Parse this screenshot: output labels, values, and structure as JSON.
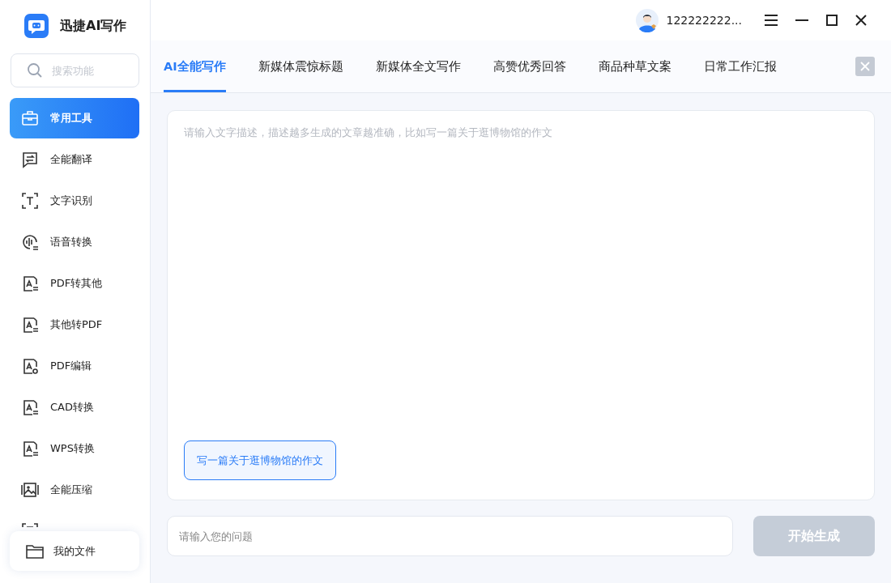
{
  "app": {
    "title": "迅捷AI写作"
  },
  "search": {
    "placeholder": "搜索功能"
  },
  "sidebar": {
    "items": [
      {
        "label": "常用工具",
        "kind": "toolbox",
        "selected": true
      },
      {
        "label": "全能翻译",
        "kind": "translate",
        "selected": false
      },
      {
        "label": "文字识别",
        "kind": "ocr",
        "selected": false
      },
      {
        "label": "语音转换",
        "kind": "voice",
        "selected": false
      },
      {
        "label": "PDF转其他",
        "kind": "pdf-out",
        "selected": false
      },
      {
        "label": "其他转PDF",
        "kind": "pdf-in",
        "selected": false
      },
      {
        "label": "PDF编辑",
        "kind": "pdf-edit",
        "selected": false
      },
      {
        "label": "CAD转换",
        "kind": "cad",
        "selected": false
      },
      {
        "label": "WPS转换",
        "kind": "wps",
        "selected": false
      },
      {
        "label": "全能压缩",
        "kind": "compress",
        "selected": false
      }
    ],
    "files": "我的文件"
  },
  "user": {
    "name": "122222222..."
  },
  "tabs": [
    {
      "label": "AI全能写作",
      "selected": true
    },
    {
      "label": "新媒体震惊标题",
      "selected": false
    },
    {
      "label": "新媒体全文写作",
      "selected": false
    },
    {
      "label": "高赞优秀回答",
      "selected": false
    },
    {
      "label": "商品种草文案",
      "selected": false
    },
    {
      "label": "日常工作汇报",
      "selected": false
    }
  ],
  "editor": {
    "placeholder": "请输入文字描述，描述越多生成的文章越准确，比如写一篇关于逛博物馆的作文",
    "suggestion": "写一篇关于逛博物馆的作文"
  },
  "question": {
    "placeholder": "请输入您的问题"
  },
  "generate": {
    "label": "开始生成",
    "disabled": true
  }
}
